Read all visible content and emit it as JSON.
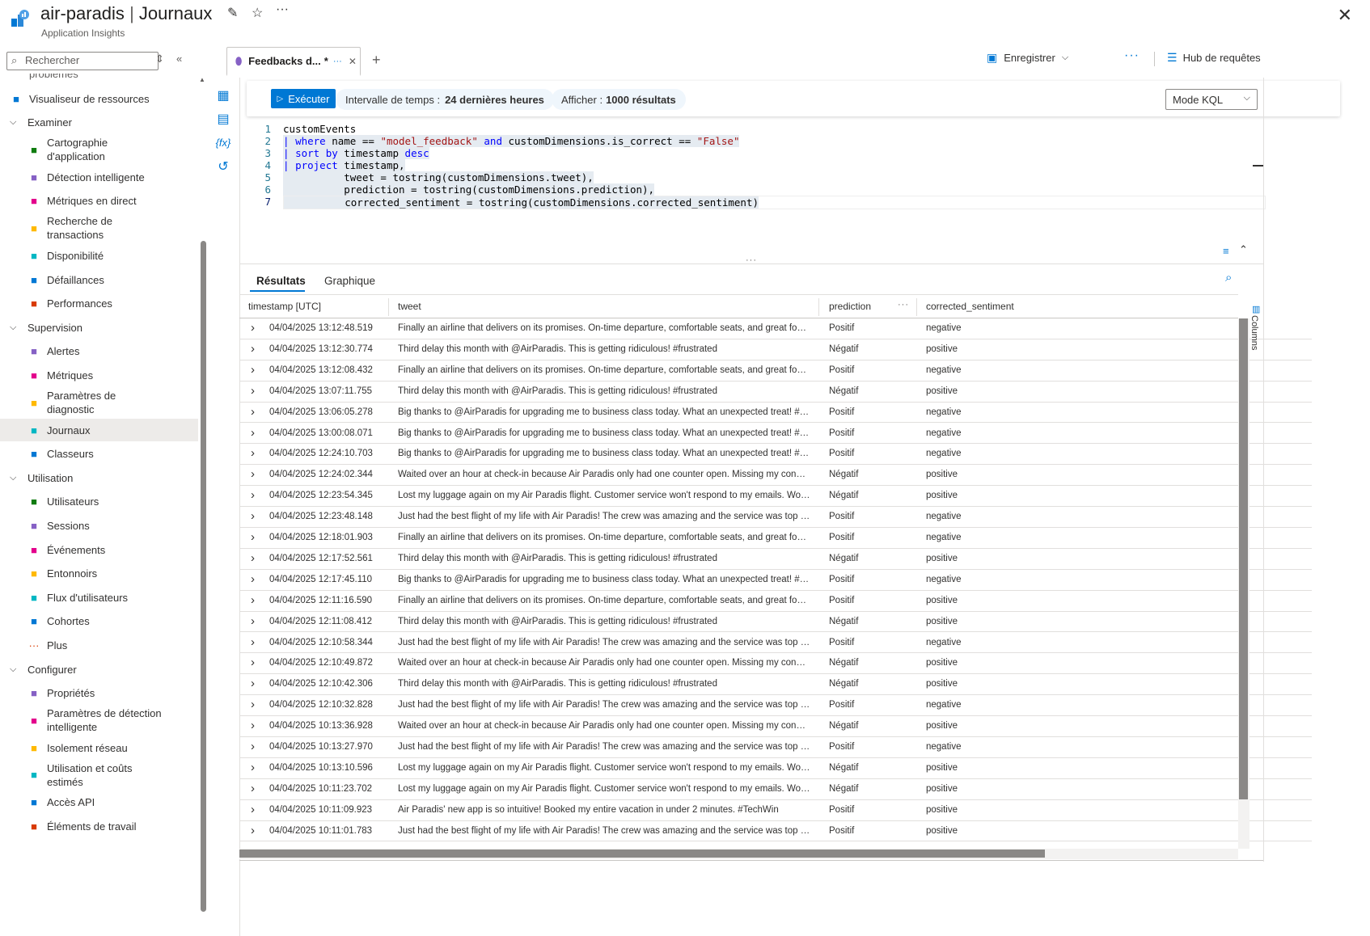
{
  "header": {
    "app_name": "air-paradis",
    "separator": "|",
    "page": "Journaux",
    "subtitle": "Application Insights"
  },
  "sidebar": {
    "search_placeholder": "Rechercher",
    "cut_item": "problèmes",
    "items": [
      {
        "type": "item",
        "label": "Visualiseur de ressources",
        "icon": "resource-visualizer-icon"
      },
      {
        "type": "group",
        "label": "Examiner"
      },
      {
        "type": "item",
        "label": "Cartographie\nd'application",
        "icon": "app-map-icon"
      },
      {
        "type": "item",
        "label": "Détection intelligente",
        "icon": "smart-detection-icon"
      },
      {
        "type": "item",
        "label": "Métriques en direct",
        "icon": "live-metrics-icon"
      },
      {
        "type": "item",
        "label": "Recherche de\ntransactions",
        "icon": "transaction-search-icon"
      },
      {
        "type": "item",
        "label": "Disponibilité",
        "icon": "availability-icon"
      },
      {
        "type": "item",
        "label": "Défaillances",
        "icon": "failures-icon"
      },
      {
        "type": "item",
        "label": "Performances",
        "icon": "performance-icon"
      },
      {
        "type": "group",
        "label": "Supervision"
      },
      {
        "type": "item",
        "label": "Alertes",
        "icon": "alerts-icon"
      },
      {
        "type": "item",
        "label": "Métriques",
        "icon": "metrics-icon"
      },
      {
        "type": "item",
        "label": "Paramètres de\ndiagnostic",
        "icon": "diagnostic-settings-icon"
      },
      {
        "type": "item",
        "label": "Journaux",
        "icon": "logs-icon",
        "active": true
      },
      {
        "type": "item",
        "label": "Classeurs",
        "icon": "workbooks-icon"
      },
      {
        "type": "group",
        "label": "Utilisation"
      },
      {
        "type": "item",
        "label": "Utilisateurs",
        "icon": "users-icon"
      },
      {
        "type": "item",
        "label": "Sessions",
        "icon": "sessions-icon"
      },
      {
        "type": "item",
        "label": "Événements",
        "icon": "events-icon"
      },
      {
        "type": "item",
        "label": "Entonnoirs",
        "icon": "funnels-icon"
      },
      {
        "type": "item",
        "label": "Flux d'utilisateurs",
        "icon": "user-flows-icon"
      },
      {
        "type": "item",
        "label": "Cohortes",
        "icon": "cohorts-icon"
      },
      {
        "type": "item",
        "label": "Plus",
        "icon": "more-icon"
      },
      {
        "type": "group",
        "label": "Configurer"
      },
      {
        "type": "item",
        "label": "Propriétés",
        "icon": "properties-icon"
      },
      {
        "type": "item",
        "label": "Paramètres de détection\nintelligente",
        "icon": "smart-detection-settings-icon"
      },
      {
        "type": "item",
        "label": "Isolement réseau",
        "icon": "network-isolation-icon"
      },
      {
        "type": "item",
        "label": "Utilisation et coûts\nestimés",
        "icon": "usage-costs-icon"
      },
      {
        "type": "item",
        "label": "Accès API",
        "icon": "api-access-icon"
      },
      {
        "type": "item",
        "label": "Éléments de travail",
        "icon": "work-items-icon"
      }
    ]
  },
  "tabs": {
    "query_tab": "Feedbacks d...",
    "unsaved_mark": "*",
    "save_label": "Enregistrer",
    "hub_label": "Hub de requêtes"
  },
  "toolbar": {
    "run_label": "Exécuter",
    "time_label": "Intervalle de temps :",
    "time_value": "24 dernières heures",
    "show_label": "Afficher :",
    "show_value": "1000 résultats",
    "mode_label": "Mode KQL"
  },
  "editor": {
    "line_numbers": [
      "1",
      "2",
      "3",
      "4",
      "5",
      "6",
      "7"
    ]
  },
  "results": {
    "tab_results": "Résultats",
    "tab_chart": "Graphique",
    "columns": [
      "timestamp [UTC]",
      "tweet",
      "prediction",
      "corrected_sentiment"
    ],
    "columns_panel": "Columns",
    "rows": [
      [
        "04/04/2025 13:12:48.519",
        "Finally an airline that delivers on its promises. On-time departure, comfortable seats, and great food o...",
        "Positif",
        "negative"
      ],
      [
        "04/04/2025 13:12:30.774",
        "Third delay this month with @AirParadis. This is getting ridiculous! #frustrated",
        "Négatif",
        "positive"
      ],
      [
        "04/04/2025 13:12:08.432",
        "Finally an airline that delivers on its promises. On-time departure, comfortable seats, and great food o...",
        "Positif",
        "negative"
      ],
      [
        "04/04/2025 13:07:11.755",
        "Third delay this month with @AirParadis. This is getting ridiculous! #frustrated",
        "Négatif",
        "positive"
      ],
      [
        "04/04/2025 13:06:05.278",
        "Big thanks to @AirParadis for upgrading me to business class today. What an unexpected treat! #Cust...",
        "Positif",
        "negative"
      ],
      [
        "04/04/2025 13:00:08.071",
        "Big thanks to @AirParadis for upgrading me to business class today. What an unexpected treat! #Cust...",
        "Positif",
        "negative"
      ],
      [
        "04/04/2025 12:24:10.703",
        "Big thanks to @AirParadis for upgrading me to business class today. What an unexpected treat! #Cust...",
        "Positif",
        "negative"
      ],
      [
        "04/04/2025 12:24:02.344",
        "Waited over an hour at check-in because Air Paradis only had one counter open. Missing my connecti...",
        "Négatif",
        "positive"
      ],
      [
        "04/04/2025 12:23:54.345",
        "Lost my luggage again on my Air Paradis flight. Customer service won't respond to my emails. Worst e...",
        "Négatif",
        "positive"
      ],
      [
        "04/04/2025 12:23:48.148",
        "Just had the best flight of my life with Air Paradis! The crew was amazing and the service was top notch!",
        "Positif",
        "negative"
      ],
      [
        "04/04/2025 12:18:01.903",
        "Finally an airline that delivers on its promises. On-time departure, comfortable seats, and great food o...",
        "Positif",
        "negative"
      ],
      [
        "04/04/2025 12:17:52.561",
        "Third delay this month with @AirParadis. This is getting ridiculous! #frustrated",
        "Négatif",
        "positive"
      ],
      [
        "04/04/2025 12:17:45.110",
        "Big thanks to @AirParadis for upgrading me to business class today. What an unexpected treat! #Cust...",
        "Positif",
        "negative"
      ],
      [
        "04/04/2025 12:11:16.590",
        "Finally an airline that delivers on its promises. On-time departure, comfortable seats, and great food o...",
        "Positif",
        "positive"
      ],
      [
        "04/04/2025 12:11:08.412",
        "Third delay this month with @AirParadis. This is getting ridiculous! #frustrated",
        "Négatif",
        "positive"
      ],
      [
        "04/04/2025 12:10:58.344",
        "Just had the best flight of my life with Air Paradis! The crew was amazing and the service was top notch!",
        "Positif",
        "negative"
      ],
      [
        "04/04/2025 12:10:49.872",
        "Waited over an hour at check-in because Air Paradis only had one counter open. Missing my connecti...",
        "Négatif",
        "positive"
      ],
      [
        "04/04/2025 12:10:42.306",
        "Third delay this month with @AirParadis. This is getting ridiculous! #frustrated",
        "Négatif",
        "positive"
      ],
      [
        "04/04/2025 12:10:32.828",
        "Just had the best flight of my life with Air Paradis! The crew was amazing and the service was top notch!",
        "Positif",
        "negative"
      ],
      [
        "04/04/2025 10:13:36.928",
        "Waited over an hour at check-in because Air Paradis only had one counter open. Missing my connecti...",
        "Négatif",
        "positive"
      ],
      [
        "04/04/2025 10:13:27.970",
        "Just had the best flight of my life with Air Paradis! The crew was amazing and the service was top notch!",
        "Positif",
        "negative"
      ],
      [
        "04/04/2025 10:13:10.596",
        "Lost my luggage again on my Air Paradis flight. Customer service won't respond to my emails. Worst e...",
        "Négatif",
        "positive"
      ],
      [
        "04/04/2025 10:11:23.702",
        "Lost my luggage again on my Air Paradis flight. Customer service won't respond to my emails. Worst e...",
        "Négatif",
        "positive"
      ],
      [
        "04/04/2025 10:11:09.923",
        "Air Paradis' new app is so intuitive! Booked my entire vacation in under 2 minutes. #TechWin",
        "Positif",
        "positive"
      ],
      [
        "04/04/2025 10:11:01.783",
        "Just had the best flight of my life with Air Paradis! The crew was amazing and the service was top notch!",
        "Positif",
        "positive"
      ]
    ]
  },
  "colors": {
    "accent": "#0078d4",
    "active_nav": "#edebe9",
    "pill_bg": "#eff6fc"
  }
}
